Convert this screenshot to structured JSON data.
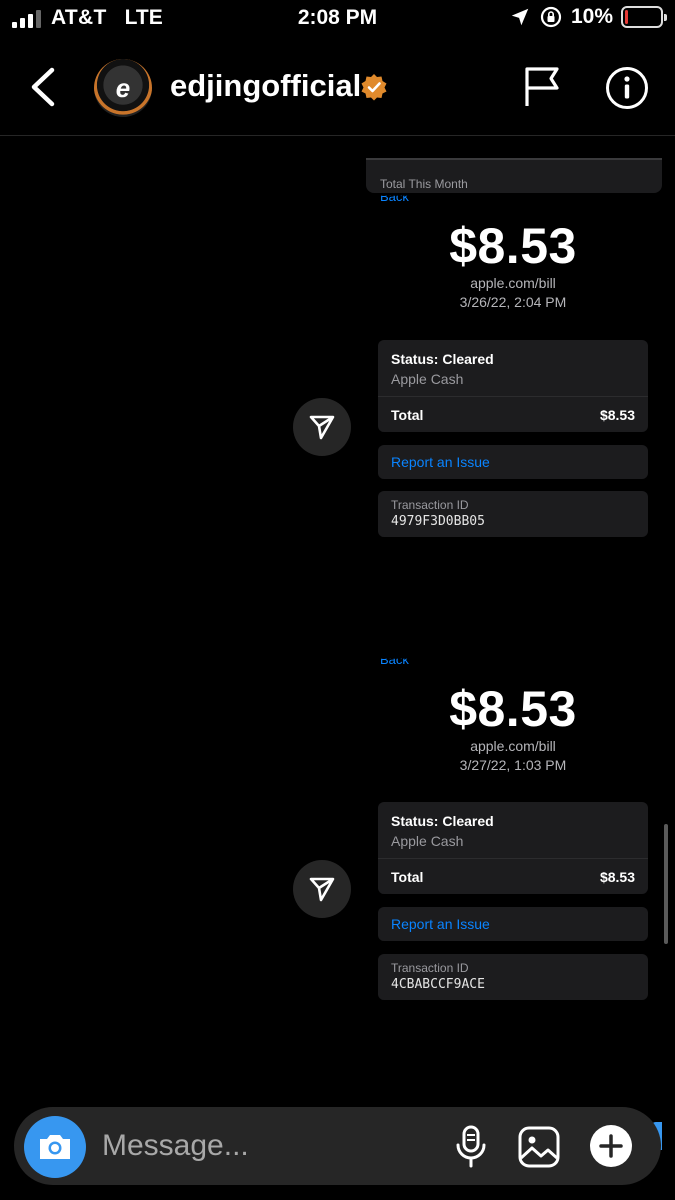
{
  "status_bar": {
    "carrier": "AT&T",
    "network": "LTE",
    "time": "2:08 PM",
    "battery": "10%",
    "battery_level": 0.1,
    "battery_color": "#e53935"
  },
  "header": {
    "username": "edjingofficial",
    "avatar_letter": "e",
    "verified_badge_color": "#e08a2c",
    "icons": [
      "back-icon",
      "flag-icon",
      "info-icon"
    ]
  },
  "previous_card": {
    "label": "Total This Month"
  },
  "payments": [
    {
      "back_label": "Back",
      "amount": "$8.53",
      "merchant": "apple.com/bill",
      "date": "3/26/22, 2:04 PM",
      "status": "Status: Cleared",
      "method": "Apple Cash",
      "total_label": "Total",
      "total_value": "$8.53",
      "report_label": "Report an Issue",
      "txn_label": "Transaction ID",
      "txn_id": "4979F3D0BB05"
    },
    {
      "back_label": "Back",
      "amount": "$8.53",
      "merchant": "apple.com/bill",
      "date": "3/27/22, 1:03 PM",
      "status": "Status: Cleared",
      "method": "Apple Cash",
      "total_label": "Total",
      "total_value": "$8.53",
      "report_label": "Report an Issue",
      "txn_label": "Transaction ID",
      "txn_id": "4CBABCCF9ACE"
    }
  ],
  "composer": {
    "placeholder": "Message...",
    "accent_color": "#3797f0",
    "icons": [
      "camera-icon",
      "microphone-icon",
      "gallery-icon",
      "plus-icon"
    ]
  },
  "colors": {
    "link": "#0a84ff",
    "card_background": "#1c1c1e"
  }
}
